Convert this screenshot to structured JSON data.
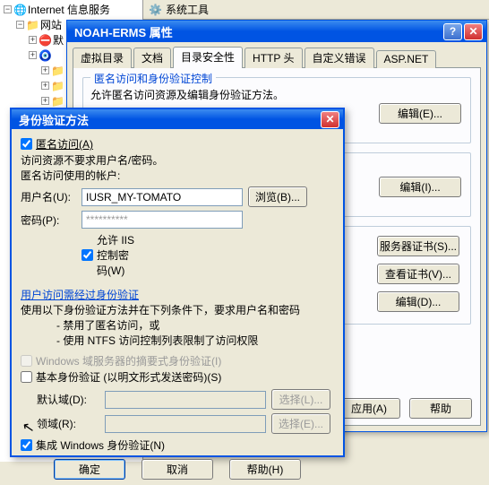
{
  "tree": {
    "root": "Internet 信息服务",
    "website": "网站",
    "default": "默"
  },
  "toolbar": {
    "systools": "系统工具"
  },
  "propDlg": {
    "title": "NOAH-ERMS 属性",
    "tabs": {
      "virtualdir": "虚拟目录",
      "documents": "文档",
      "dirsec": "目录安全性",
      "httphead": "HTTP 头",
      "customerr": "自定义错误",
      "aspnet": "ASP.NET"
    },
    "group1": {
      "legend": "匿名访问和身份验证控制",
      "desc": "允许匿名访问资源及编辑身份验证方法。",
      "edit_btn": "编辑(E)..."
    },
    "group2": {
      "edit_btn": "编辑(I)..."
    },
    "group3": {
      "srv_cert": "服务器证书(S)...",
      "view_cert": "查看证书(V)...",
      "edit": "编辑(D)..."
    },
    "bottom": {
      "apply": "应用(A)",
      "help": "帮助"
    }
  },
  "authDlg": {
    "title": "身份验证方法",
    "anon_access": "匿名访问(A)",
    "anon_note1": "访问资源不要求用户名/密码。",
    "anon_note2": "匿名访问使用的帐户:",
    "username_lbl": "用户名(U):",
    "username_val": "IUSR_MY-TOMATO",
    "browse_btn": "浏览(B)...",
    "password_lbl": "密码(P):",
    "password_val": "**********",
    "allow_iis": "允许 IIS 控制密码(W)",
    "auth_access_hdr": "用户访问需经过身份验证",
    "auth_desc": "使用以下身份验证方法并在下列条件下，要求用户名和密码",
    "bullet1": "- 禁用了匿名访问，或",
    "bullet2": "- 使用 NTFS 访问控制列表限制了访问权限",
    "digest": "Windows 域服务器的摘要式身份验证(I)",
    "basic": "基本身份验证 (以明文形式发送密码)(S)",
    "default_domain_lbl": "默认域(D):",
    "realm_lbl": "领域(R):",
    "select_btn": "选择(L)...",
    "select_btn2": "选择(E)...",
    "integrated": "集成 Windows 身份验证(N)",
    "ok": "确定",
    "cancel": "取消",
    "help": "帮助(H)"
  }
}
